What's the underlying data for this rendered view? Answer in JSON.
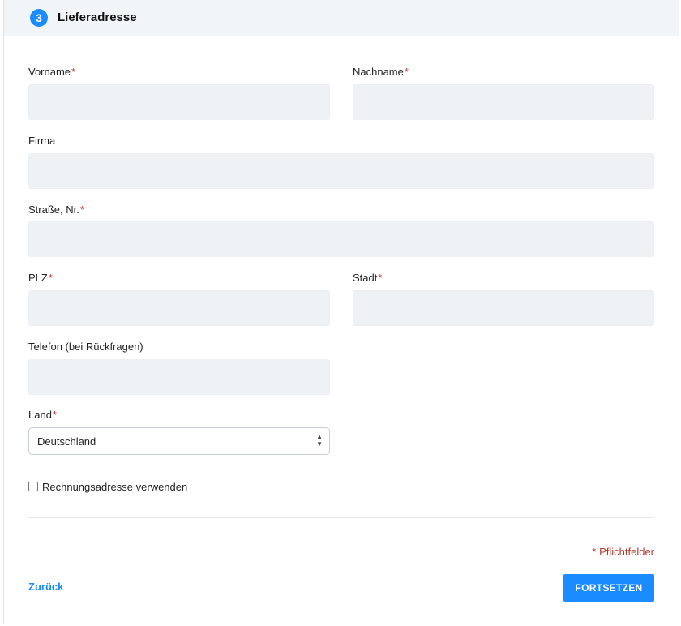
{
  "header": {
    "step_number": "3",
    "title": "Lieferadresse"
  },
  "fields": {
    "vorname": {
      "label": "Vorname",
      "required_mark": "*",
      "value": ""
    },
    "nachname": {
      "label": "Nachname",
      "required_mark": "*",
      "value": ""
    },
    "firma": {
      "label": "Firma",
      "value": ""
    },
    "strasse": {
      "label": "Straße, Nr.",
      "required_mark": "*",
      "value": ""
    },
    "plz": {
      "label": "PLZ",
      "required_mark": "*",
      "value": ""
    },
    "stadt": {
      "label": "Stadt",
      "required_mark": "*",
      "value": ""
    },
    "telefon": {
      "label": "Telefon (bei Rückfragen)",
      "value": ""
    },
    "land": {
      "label": "Land",
      "required_mark": "*",
      "selected": "Deutschland",
      "arrow_up": "▲",
      "arrow_down": "▼"
    }
  },
  "checkbox": {
    "label": "Rechnungsadresse verwenden",
    "checked": false
  },
  "required_note": "* Pflichtfelder",
  "actions": {
    "back_label": "Zurück",
    "continue_label": "FORTSETZEN"
  },
  "colors": {
    "accent": "#1a8cff",
    "required": "#c0392b",
    "input_bg": "#eff2f5"
  }
}
